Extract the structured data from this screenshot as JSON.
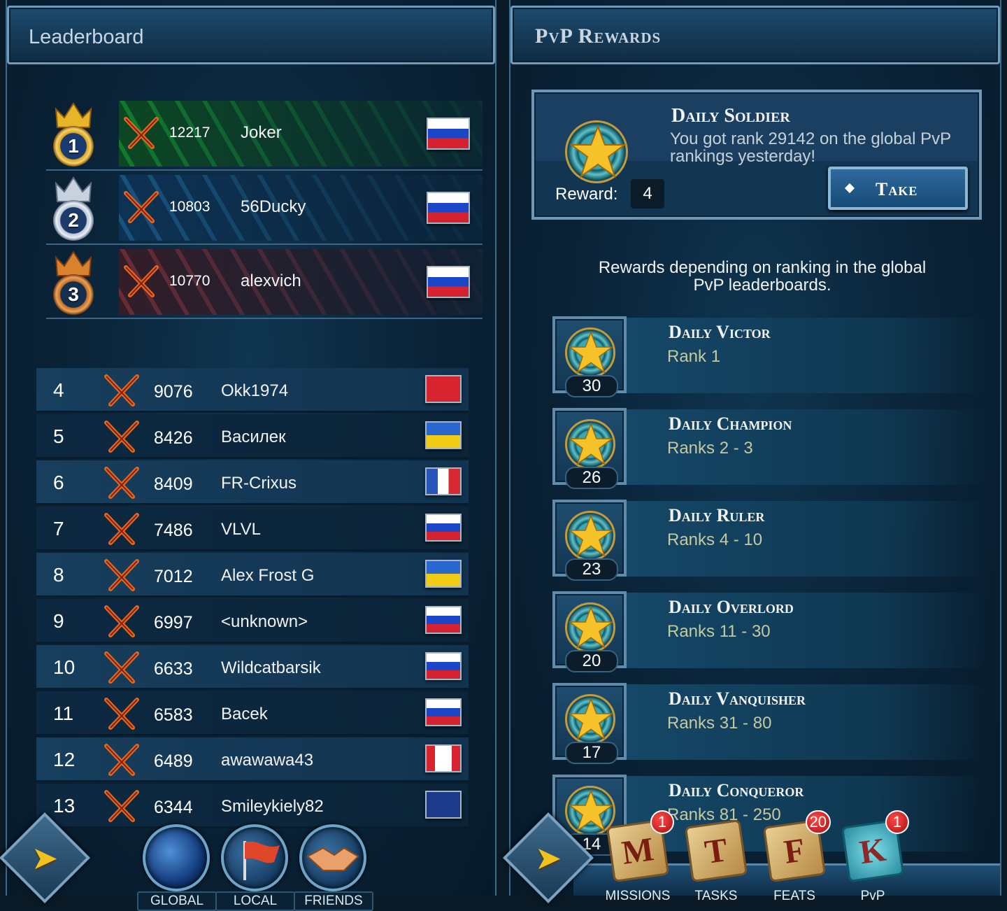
{
  "left": {
    "title": "Leaderboard",
    "top3": [
      {
        "rank": "1",
        "score": "12217",
        "name": "Joker",
        "flag": "ru"
      },
      {
        "rank": "2",
        "score": "10803",
        "name": "56Ducky",
        "flag": "ru"
      },
      {
        "rank": "3",
        "score": "10770",
        "name": "alexvich",
        "flag": "ru"
      }
    ],
    "rows": [
      {
        "rank": "4",
        "score": "9076",
        "name": "Okk1974",
        "flag": "tr"
      },
      {
        "rank": "5",
        "score": "8426",
        "name": "Василек",
        "flag": "ua"
      },
      {
        "rank": "6",
        "score": "8409",
        "name": "FR-Crixus",
        "flag": "fr"
      },
      {
        "rank": "7",
        "score": "7486",
        "name": "VLVL",
        "flag": "ru"
      },
      {
        "rank": "8",
        "score": "7012",
        "name": "Alex Frost G",
        "flag": "ua"
      },
      {
        "rank": "9",
        "score": "6997",
        "name": "<unknown>",
        "flag": "ru"
      },
      {
        "rank": "10",
        "score": "6633",
        "name": "Wildcatbarsik",
        "flag": "ru"
      },
      {
        "rank": "11",
        "score": "6583",
        "name": "Bacek",
        "flag": "ru"
      },
      {
        "rank": "12",
        "score": "6489",
        "name": "awawawa43",
        "flag": "ca"
      },
      {
        "rank": "13",
        "score": "6344",
        "name": "Smileykiely82",
        "flag": "gb"
      }
    ],
    "tabs": {
      "global": "GLOBAL",
      "local": "LOCAL",
      "friends": "FRIENDS"
    }
  },
  "right": {
    "title": "PvP Rewards",
    "daily": {
      "title": "Daily Soldier",
      "desc": "You got rank 29142 on the global PvP rankings yesterday!",
      "reward_label": "Reward:",
      "reward_value": "4",
      "take_label": "Take"
    },
    "info": "Rewards depending on ranking in the global PvP leaderboards.",
    "tiers": [
      {
        "name": "Daily Victor",
        "ranks": "Rank 1",
        "count": "30"
      },
      {
        "name": "Daily Champion",
        "ranks": "Ranks 2 - 3",
        "count": "26"
      },
      {
        "name": "Daily Ruler",
        "ranks": "Ranks 4 - 10",
        "count": "23"
      },
      {
        "name": "Daily Overlord",
        "ranks": "Ranks 11 - 30",
        "count": "20"
      },
      {
        "name": "Daily Vanquisher",
        "ranks": "Ranks 31 - 80",
        "count": "17"
      },
      {
        "name": "Daily Conqueror",
        "ranks": "Ranks 81 - 250",
        "count": "14"
      }
    ],
    "tabs": [
      {
        "letter": "M",
        "label": "MISSIONS",
        "badge": "1"
      },
      {
        "letter": "T",
        "label": "TASKS",
        "badge": ""
      },
      {
        "letter": "F",
        "label": "FEATS",
        "badge": "20"
      },
      {
        "letter": "K",
        "label": "PvP",
        "badge": "1"
      }
    ]
  },
  "colors": {
    "accent_gold": "#f2c21e",
    "badge_red": "#d01818",
    "panel_bg": "#0a2236"
  }
}
